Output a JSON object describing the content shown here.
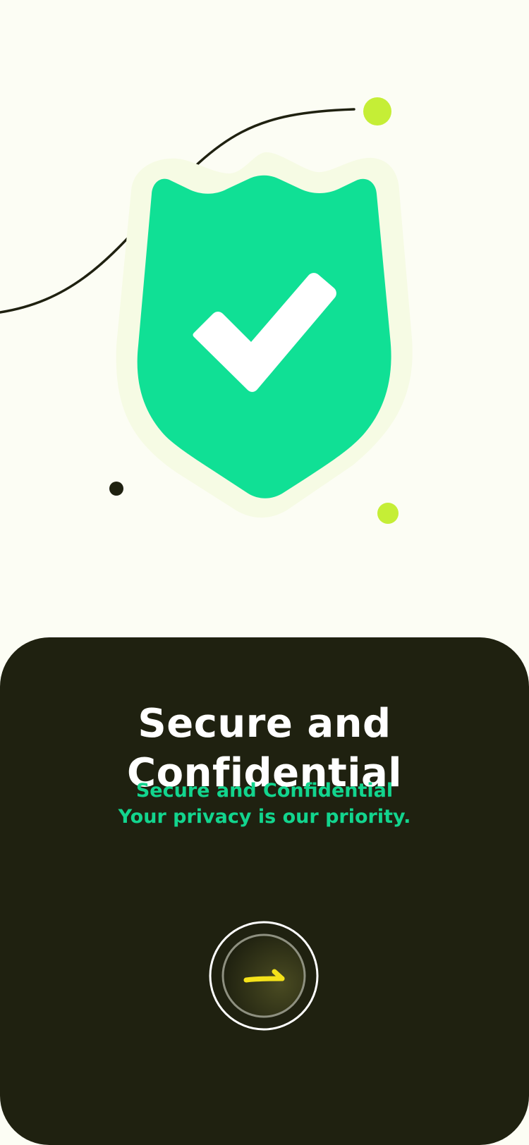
{
  "onboarding": {
    "title": "Secure and Confidential",
    "subtitle_line1": "Secure and Confidential",
    "subtitle_line2": "Your privacy is our priority.",
    "next_icon": "arrow-right-icon"
  },
  "illustration": {
    "icon": "shield-check-icon",
    "colors": {
      "shield": "#10e095",
      "shield_halo": "#f6fbe4",
      "check": "#ffffff",
      "accent_dot": "#c5ee36",
      "dark": "#1f2110"
    }
  },
  "colors": {
    "background": "#fcfdf4",
    "panel": "#1f2110",
    "title": "#ffffff",
    "subtitle": "#12d58e",
    "arrow": "#f4e21a"
  }
}
